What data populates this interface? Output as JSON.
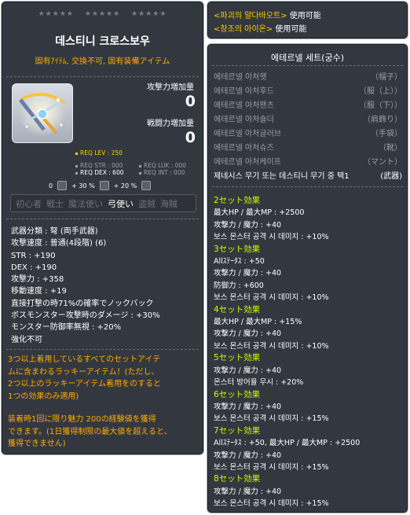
{
  "item": {
    "stars_groups": [
      "★★★★★",
      "★★★★★",
      "★★★★★"
    ],
    "name": "데스티니 크로스보우",
    "subtitle": "固有ｱｲﾃﾑ, 交換不可, 固有装備アイテム",
    "attack_increase_label": "攻撃力増加量",
    "attack_increase_value": "0",
    "combat_increase_label": "戦闘力増加量",
    "combat_increase_value": "0",
    "req": {
      "lev": "REQ LEV : 250",
      "str": "REQ STR : 000",
      "luk": "REQ LUK : 000",
      "dex": "REQ DEX : 600",
      "int": "REQ INT : 000"
    },
    "bonus": [
      "0",
      "+ 30 %",
      "+ 20 %"
    ],
    "jobs": [
      "初心者",
      "戦士",
      "魔法使い",
      "弓使い",
      "盗賊",
      "海賊"
    ],
    "active_job_index": 3,
    "attributes": [
      "武器分類 : 弩 (両手武器)",
      "攻撃速度 : 普通(4段階) (6)",
      "STR : +190",
      "DEX : +190",
      "攻撃力 : +358",
      "移動速度 : +19",
      "直接打撃の時71%の確率でノックバック",
      "ボスモンスター攻撃時のダメージ : +30%",
      "モンスター防御率無視 : +20%",
      "強化不可"
    ],
    "description1": [
      " 3つ以上着用しているすべてのセットアイテ",
      "ムに含まわるラッキーアイテム！(ただし、",
      "2つ以上のラッキーアイテム着用をのすると",
      "1つの効果のみ適用)"
    ],
    "description2": [
      " 装着時1回に限り魅力 200の経験値を獲得",
      "できます。(1日獲得制限の最大値を超えると、",
      "獲得できません)"
    ]
  },
  "skills": [
    {
      "name": "<파괴의 얄다바오트>",
      "suffix": " 使用可能"
    },
    {
      "name": "<창조의 아이온>",
      "suffix": " 使用可能"
    }
  ],
  "set": {
    "title": "에테르넬 세트(궁수)",
    "parts": [
      {
        "name": "에테르넬 아처햇",
        "slot": "（帽子）"
      },
      {
        "name": "에테르넬 아처후드",
        "slot": "（服（上））"
      },
      {
        "name": "에테르넬 아처팬츠",
        "slot": "（服（下））"
      },
      {
        "name": "에테르넬 아처숄더",
        "slot": "（肩飾り）"
      },
      {
        "name": "에테르넬 아처글러브",
        "slot": "（手袋）"
      },
      {
        "name": "에테르넬 아처슈즈",
        "slot": "（靴）"
      },
      {
        "name": "에테르넬 아처케이프",
        "slot": "（マント）"
      },
      {
        "name": "제네시스 무기 또는 데스티니 무기 중 택1",
        "slot": "(武器)"
      }
    ],
    "effects": [
      {
        "header": "2セット効果",
        "lines": [
          "最大HP / 最大MP : +2500",
          "攻撃力 / 魔力 : +40",
          "보스 몬스터 공격 시 데미지 : +10%"
        ]
      },
      {
        "header": "3セット効果",
        "lines": [
          "Allｽﾃｰﾀｽ : +50",
          "攻撃力 / 魔力 : +40",
          "防御力 : +600",
          "보스 몬스터 공격 시 데미지 : +10%"
        ]
      },
      {
        "header": "4セット効果",
        "lines": [
          "最大HP / 最大MP : +15%",
          "攻撃力 / 魔力 : +40",
          "보스 몬스터 공격 시 데미지 : +10%"
        ]
      },
      {
        "header": "5セット効果",
        "lines": [
          "攻撃力 / 魔力 : +40",
          "몬스터 방어율 무시 : +20%"
        ]
      },
      {
        "header": "6セット効果",
        "lines": [
          "攻撃力 / 魔力 : +40",
          "보스 몬스터 공격 시 데미지 : +15%"
        ]
      },
      {
        "header": "7セット効果",
        "lines": [
          "Allｽﾃｰﾀｽ : +50, 最大HP / 最大MP : +2500",
          "攻撃力 / 魔力 : +40",
          "보스 몬스터 공격 시 데미지 : +15%"
        ]
      },
      {
        "header": "8セット効果",
        "lines": [
          "攻撃力 / 魔力 : +40",
          "보스 몬스터 공격 시 데미지 : +15%"
        ]
      }
    ]
  },
  "colors": {
    "panel_bg": "#333840",
    "title_gold": "#ffab00",
    "set_header": "#ccff00",
    "dim_text": "#9a9ea5"
  }
}
